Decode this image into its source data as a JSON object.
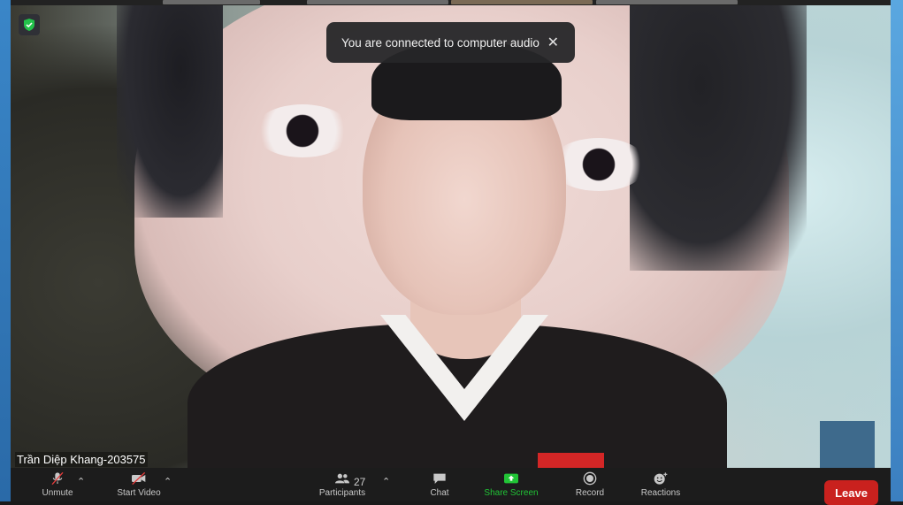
{
  "notification": {
    "message": "You are connected to computer audio",
    "close_glyph": "✕"
  },
  "participant": {
    "name": "Trần Diệp Khang-203575"
  },
  "toolbar": {
    "mute_label": "Unmute",
    "video_label": "Start Video",
    "participants_label": "Participants",
    "participants_count": "27",
    "chat_label": "Chat",
    "share_label": "Share Screen",
    "record_label": "Record",
    "reactions_label": "Reactions",
    "leave_label": "Leave"
  },
  "colors": {
    "share_green": "#21c436",
    "leave_red": "#c9211e",
    "shield_green": "#23c24b"
  }
}
